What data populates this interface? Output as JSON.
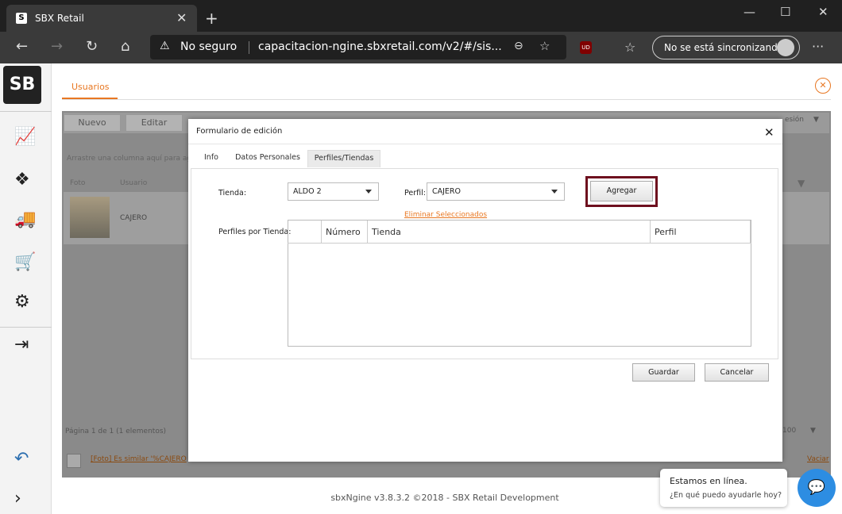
{
  "browser": {
    "tab_title": "SBX Retail",
    "tab_close": "✕",
    "new_tab": "+",
    "window_controls": {
      "minimize": "—",
      "maximize": "☐",
      "close": "✕"
    },
    "nav": {
      "back": "←",
      "forward": "→",
      "reload": "↻",
      "home": "⌂"
    },
    "security": "No seguro",
    "url": "capacitacion-ngine.sbxretail.com/v2/#/sis...",
    "sync_label": "No se está sincronizando",
    "menu": "···",
    "extension": "UD"
  },
  "app": {
    "logo": "SB",
    "active_tab": "Usuarios",
    "close_icon": "✕",
    "toolbar": {
      "new": "Nuevo",
      "edit": "Editar",
      "session": "esión"
    },
    "drag_hint": "Arrastre una columna aquí para agru",
    "columns": {
      "photo": "Foto",
      "user": "Usuario"
    },
    "row_user": "CAJERO",
    "pager": "Página 1 de 1 (1 elementos)",
    "page_size": "100",
    "filter_text": "[Foto] Es similar '%CAJERO",
    "clear": "Vaciar",
    "footer": "sbxNgine v3.8.3.2 ©2018 - SBX Retail Development"
  },
  "modal": {
    "title": "Formulario de edición",
    "close": "✕",
    "tabs": [
      "Info",
      "Datos Personales",
      "Perfiles/Tiendas"
    ],
    "store_label": "Tienda:",
    "store_value": "ALDO 2",
    "profile_label": "Perfil:",
    "profile_value": "CAJERO",
    "add_button": "Agregar",
    "remove_link": "Eliminar Seleccionados",
    "table_label": "Perfiles por Tienda:",
    "table_headers": [
      "Número",
      "Tienda",
      "Perfil"
    ],
    "save_button": "Guardar",
    "cancel_button": "Cancelar"
  },
  "chat": {
    "line1": "Estamos en línea.",
    "line2": "¿En qué puedo ayudarle hoy?",
    "icon": "💬"
  },
  "colors": {
    "accent": "#e87722",
    "highlight": "#6e0f1e",
    "chat": "#2d8de2"
  }
}
